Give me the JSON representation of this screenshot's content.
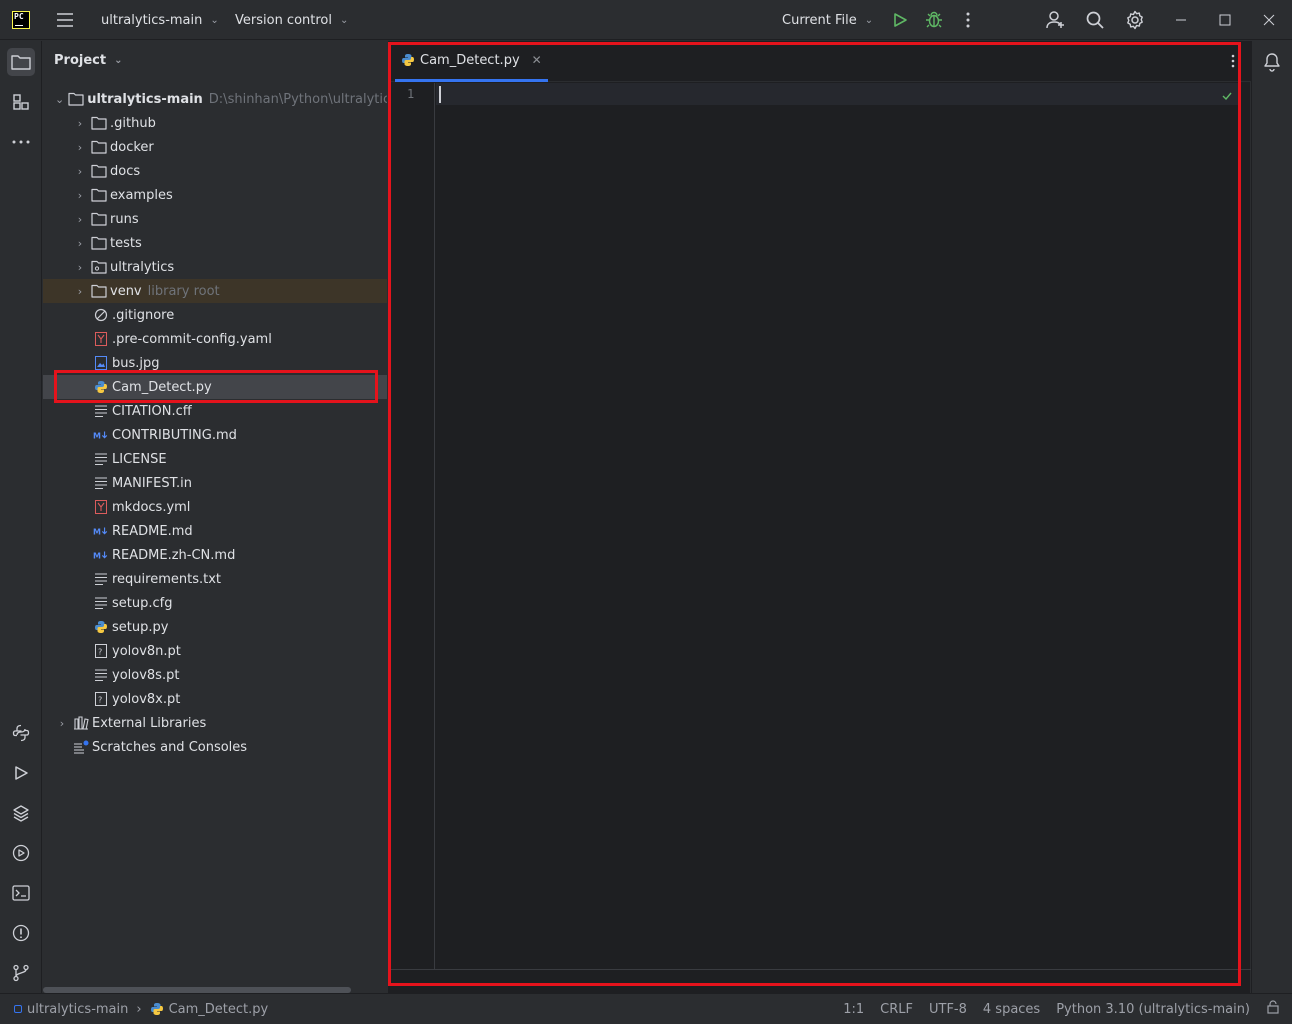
{
  "titlebar": {
    "logo_text": "PC",
    "project_name": "ultralytics-main",
    "vcs_label": "Version control",
    "run_config": "Current File"
  },
  "project_panel": {
    "title": "Project",
    "root": {
      "name": "ultralytics-main",
      "path": "D:\\shinhan\\Python\\ultralytics-r"
    },
    "folders": [
      {
        "name": ".github"
      },
      {
        "name": "docker"
      },
      {
        "name": "docs"
      },
      {
        "name": "examples"
      },
      {
        "name": "runs"
      },
      {
        "name": "tests"
      },
      {
        "name": "ultralytics"
      },
      {
        "name": "venv",
        "note": "library root"
      }
    ],
    "files": [
      {
        "name": ".gitignore",
        "icon": "ignore-icon"
      },
      {
        "name": ".pre-commit-config.yaml",
        "icon": "yaml-icon"
      },
      {
        "name": "bus.jpg",
        "icon": "image-icon"
      },
      {
        "name": "Cam_Detect.py",
        "icon": "python-icon"
      },
      {
        "name": "CITATION.cff",
        "icon": "text-icon"
      },
      {
        "name": "CONTRIBUTING.md",
        "icon": "markdown-icon"
      },
      {
        "name": "LICENSE",
        "icon": "text-icon"
      },
      {
        "name": "MANIFEST.in",
        "icon": "text-icon"
      },
      {
        "name": "mkdocs.yml",
        "icon": "yaml-icon"
      },
      {
        "name": "README.md",
        "icon": "markdown-icon"
      },
      {
        "name": "README.zh-CN.md",
        "icon": "markdown-icon"
      },
      {
        "name": "requirements.txt",
        "icon": "text-icon"
      },
      {
        "name": "setup.cfg",
        "icon": "text-icon"
      },
      {
        "name": "setup.py",
        "icon": "python-icon"
      },
      {
        "name": "yolov8n.pt",
        "icon": "unknown-icon"
      },
      {
        "name": "yolov8s.pt",
        "icon": "text-icon"
      },
      {
        "name": "yolov8x.pt",
        "icon": "unknown-icon"
      }
    ],
    "external_libraries": "External Libraries",
    "scratches": "Scratches and Consoles"
  },
  "editor": {
    "tab_label": "Cam_Detect.py",
    "line_number": "1"
  },
  "statusbar": {
    "crumb_project": "ultralytics-main",
    "crumb_file": "Cam_Detect.py",
    "position": "1:1",
    "line_sep": "CRLF",
    "encoding": "UTF-8",
    "indent": "4 spaces",
    "interpreter": "Python 3.10 (ultralytics-main)"
  },
  "colors": {
    "annotation": "#e5131c",
    "accent": "#3574f0",
    "run_green": "#5fb865"
  }
}
